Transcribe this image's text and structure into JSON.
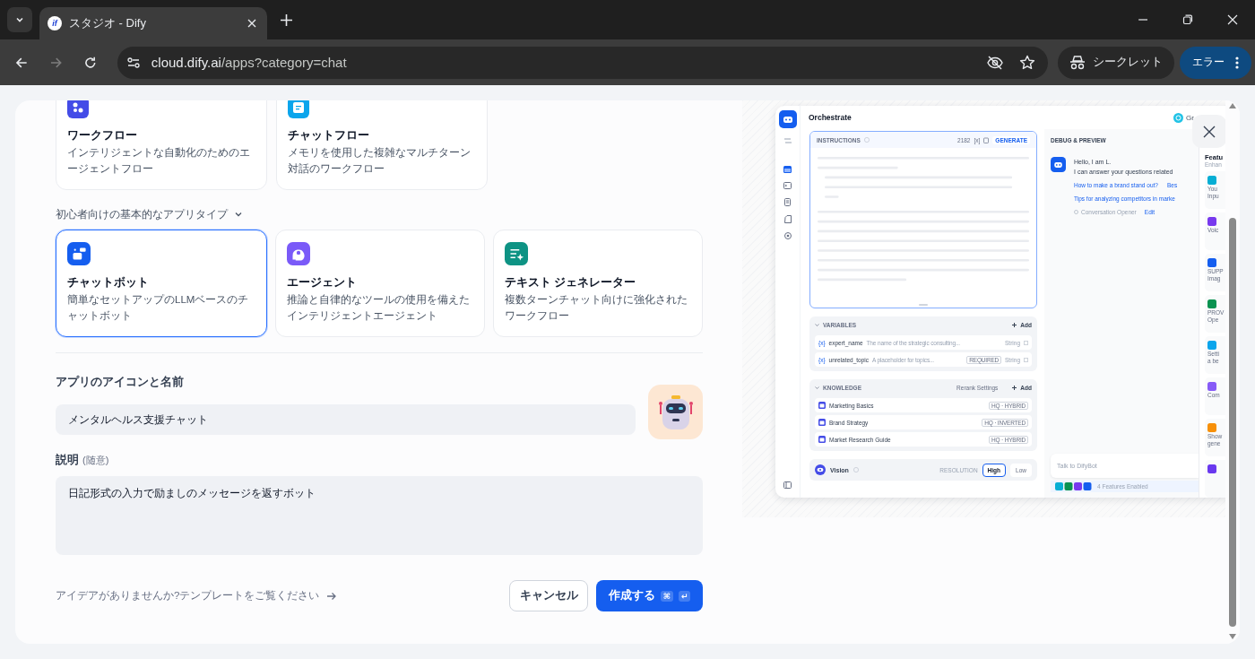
{
  "browser": {
    "favicon": "if",
    "tab_title": "スタジオ - Dify",
    "url_host": "cloud.dify.ai",
    "url_path": "/apps?category=chat",
    "incognito_label": "シークレット",
    "profile_label": "エラー"
  },
  "advanced_types": [
    {
      "kind": "workflow",
      "title": "ワークフロー",
      "desc": "インテリジェントな自動化のためのエージェントフロー",
      "selected": false
    },
    {
      "kind": "chatflow",
      "title": "チャットフロー",
      "desc": "メモリを使用した複雑なマルチターン対話のワークフロー",
      "selected": false
    }
  ],
  "basic_section": {
    "label": "初心者向けの基本的なアプリタイプ",
    "expanded": true
  },
  "basic_types": [
    {
      "kind": "chatbot",
      "title": "チャットボット",
      "desc": "簡単なセットアップのLLMベースのチャットボット",
      "selected": true
    },
    {
      "kind": "agent",
      "title": "エージェント",
      "desc": "推論と自律的なツールの使用を備えたインテリジェントエージェント",
      "selected": false
    },
    {
      "kind": "textgen",
      "title": "テキスト ジェネレーター",
      "desc": "複数ターンチャット向けに強化されたワークフロー",
      "selected": false
    }
  ],
  "name_field": {
    "label": "アプリのアイコンと名前",
    "value": "メンタルヘルス支援チャット"
  },
  "description_field": {
    "label": "説明",
    "optional": "(随意)",
    "value": "日記形式の入力で励ましのメッセージを返すボット"
  },
  "template_link": "アイデアがありませんか?テンプレートをご覧ください",
  "buttons": {
    "cancel": "キャンセル",
    "create": "作成する",
    "create_keys": [
      "⌘",
      "↵"
    ]
  },
  "preview": {
    "title": "Orchestrate",
    "top_right": "Gr",
    "instructions": {
      "label": "INSTRUCTIONS",
      "count": "2182",
      "var_mark": "[x]",
      "generate": "GENERATE"
    },
    "debug_title": "DEBUG & PREVIEW",
    "greeting": [
      "Hello, I am L.",
      "I can answer your questions related"
    ],
    "suggestion_rows": [
      [
        "How to make a brand stand out?",
        "Bes"
      ],
      [
        "Tips for analyzing competitors in marke"
      ]
    ],
    "opener": "Conversation Opener",
    "opener_edit": "Edit",
    "variables": {
      "label": "VARIABLES",
      "add": "Add",
      "items": [
        {
          "mark": "{x}",
          "name": "expert_name",
          "desc": "The name of the strategic consulting...",
          "type": "String"
        },
        {
          "mark": "{x}",
          "name": "unrelated_topic",
          "desc": "A placeholder for topics...",
          "badge": "REQUIRED",
          "type": "String"
        }
      ]
    },
    "knowledge": {
      "label": "KNOWLEDGE",
      "rerank": "Rerank Settings",
      "add": "Add",
      "items": [
        {
          "name": "Marketing Basics",
          "tag": "HQ · HYBRID"
        },
        {
          "name": "Brand Strategy",
          "tag": "HQ · INVERTED"
        },
        {
          "name": "Market Research Guide",
          "tag": "HQ · HYBRID"
        }
      ]
    },
    "vision": {
      "label": "Vision",
      "resolution": "RESOLUTION",
      "options": [
        {
          "label": "High",
          "selected": true
        },
        {
          "label": "Low",
          "selected": false
        }
      ]
    },
    "chat_placeholder": "Talk to DifyBot",
    "features_enabled": "4 Features Enabled",
    "features": {
      "title": "Featu",
      "subtitle": "Enhan",
      "items": [
        {
          "color": "#06aed4",
          "lines": [
            "You",
            "Inpu"
          ]
        },
        {
          "color": "#7839ee",
          "lines": [
            "Voic"
          ]
        },
        {
          "color": "#155eef",
          "lines": [
            "SUPP",
            "Imag"
          ]
        },
        {
          "color": "#099250",
          "lines": [
            "PROV",
            "Ope"
          ]
        },
        {
          "color": "#0ba5ec",
          "lines": [
            "Setti",
            "a be"
          ]
        },
        {
          "color": "#875bf7",
          "lines": [
            "Com"
          ]
        },
        {
          "color": "#f79009",
          "lines": [
            "Show",
            "gene"
          ]
        },
        {
          "color": "#6938ef"
        }
      ]
    }
  }
}
